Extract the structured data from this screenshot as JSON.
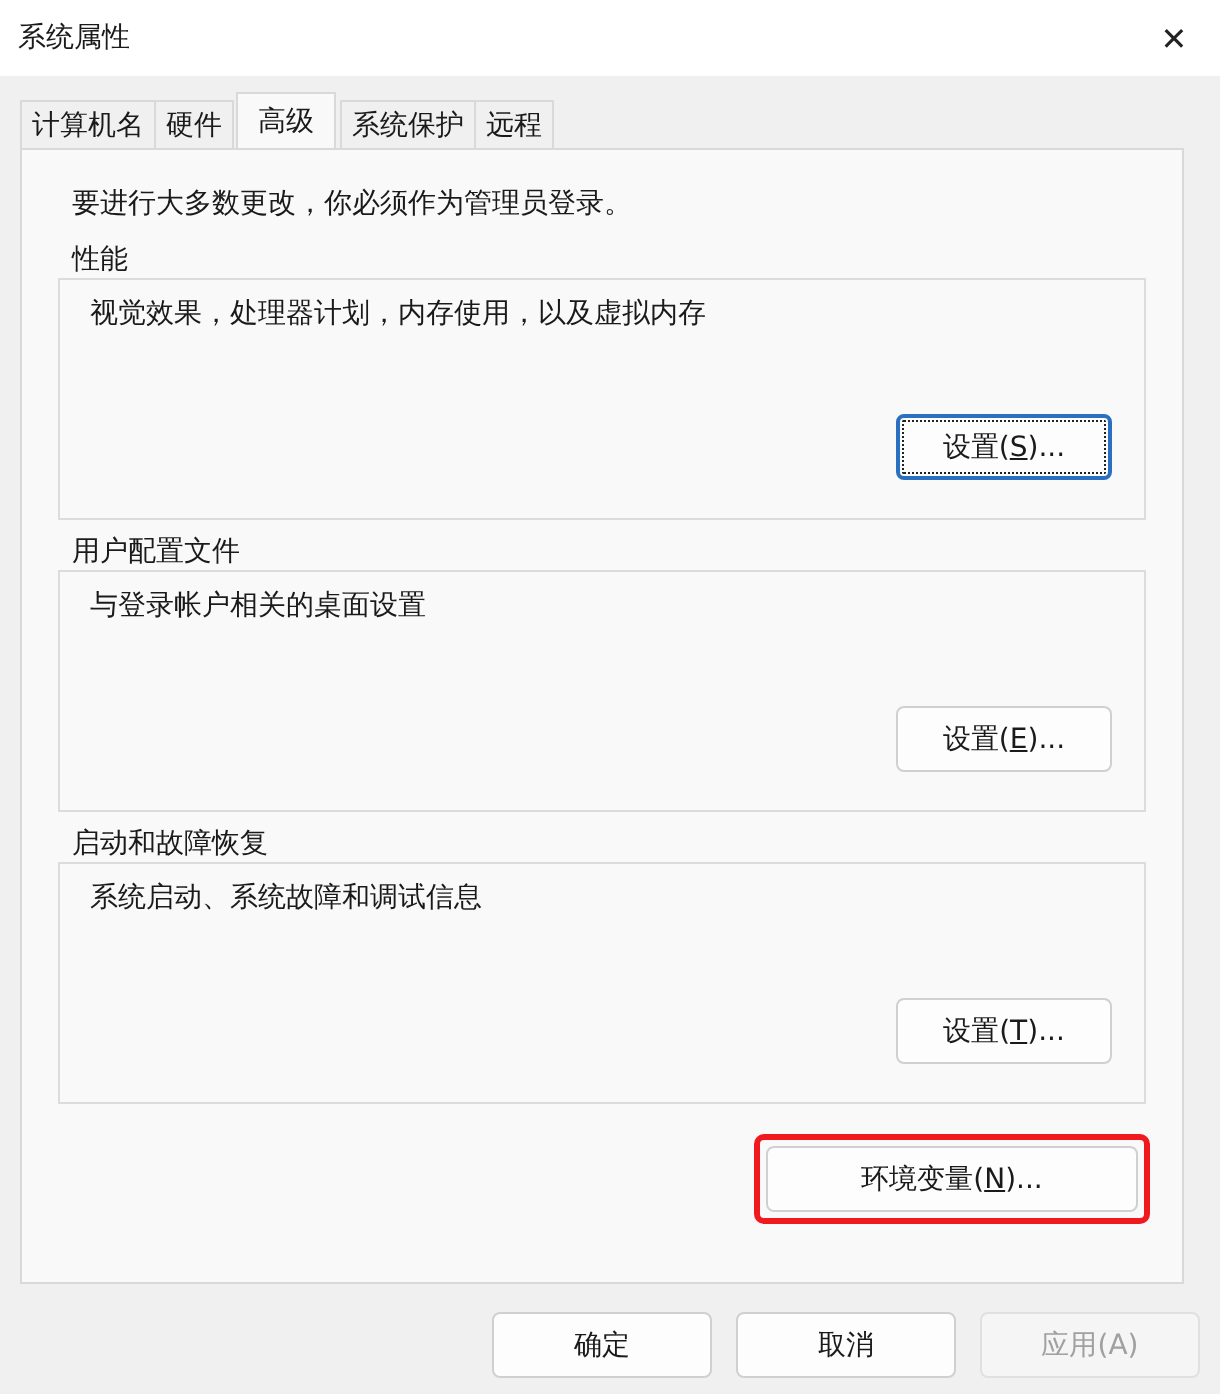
{
  "window": {
    "title": "系统属性",
    "close": "✕"
  },
  "tabs": [
    {
      "label": "计算机名",
      "selected": false
    },
    {
      "label": "硬件",
      "selected": false
    },
    {
      "label": "高级",
      "selected": true
    },
    {
      "label": "系统保护",
      "selected": false
    },
    {
      "label": "远程",
      "selected": false
    }
  ],
  "notice": "要进行大多数更改，你必须作为管理员登录。",
  "groups": [
    {
      "title": "性能",
      "description": "视觉效果，处理器计划，内存使用，以及虚拟内存",
      "button": {
        "before": "设置(",
        "key": "S",
        "after": ")...",
        "focused": true
      }
    },
    {
      "title": "用户配置文件",
      "description": "与登录帐户相关的桌面设置",
      "button": {
        "before": "设置(",
        "key": "E",
        "after": ")...",
        "focused": false
      }
    },
    {
      "title": "启动和故障恢复",
      "description": "系统启动、系统故障和调试信息",
      "button": {
        "before": "设置(",
        "key": "T",
        "after": ")...",
        "focused": false
      }
    }
  ],
  "env_button": {
    "before": "环境变量(",
    "key": "N",
    "after": ")...",
    "highlighted": true
  },
  "footer_buttons": [
    {
      "label": "确定",
      "disabled": false
    },
    {
      "label": "取消",
      "disabled": false
    },
    {
      "label": "应用(A)",
      "disabled": true
    }
  ]
}
